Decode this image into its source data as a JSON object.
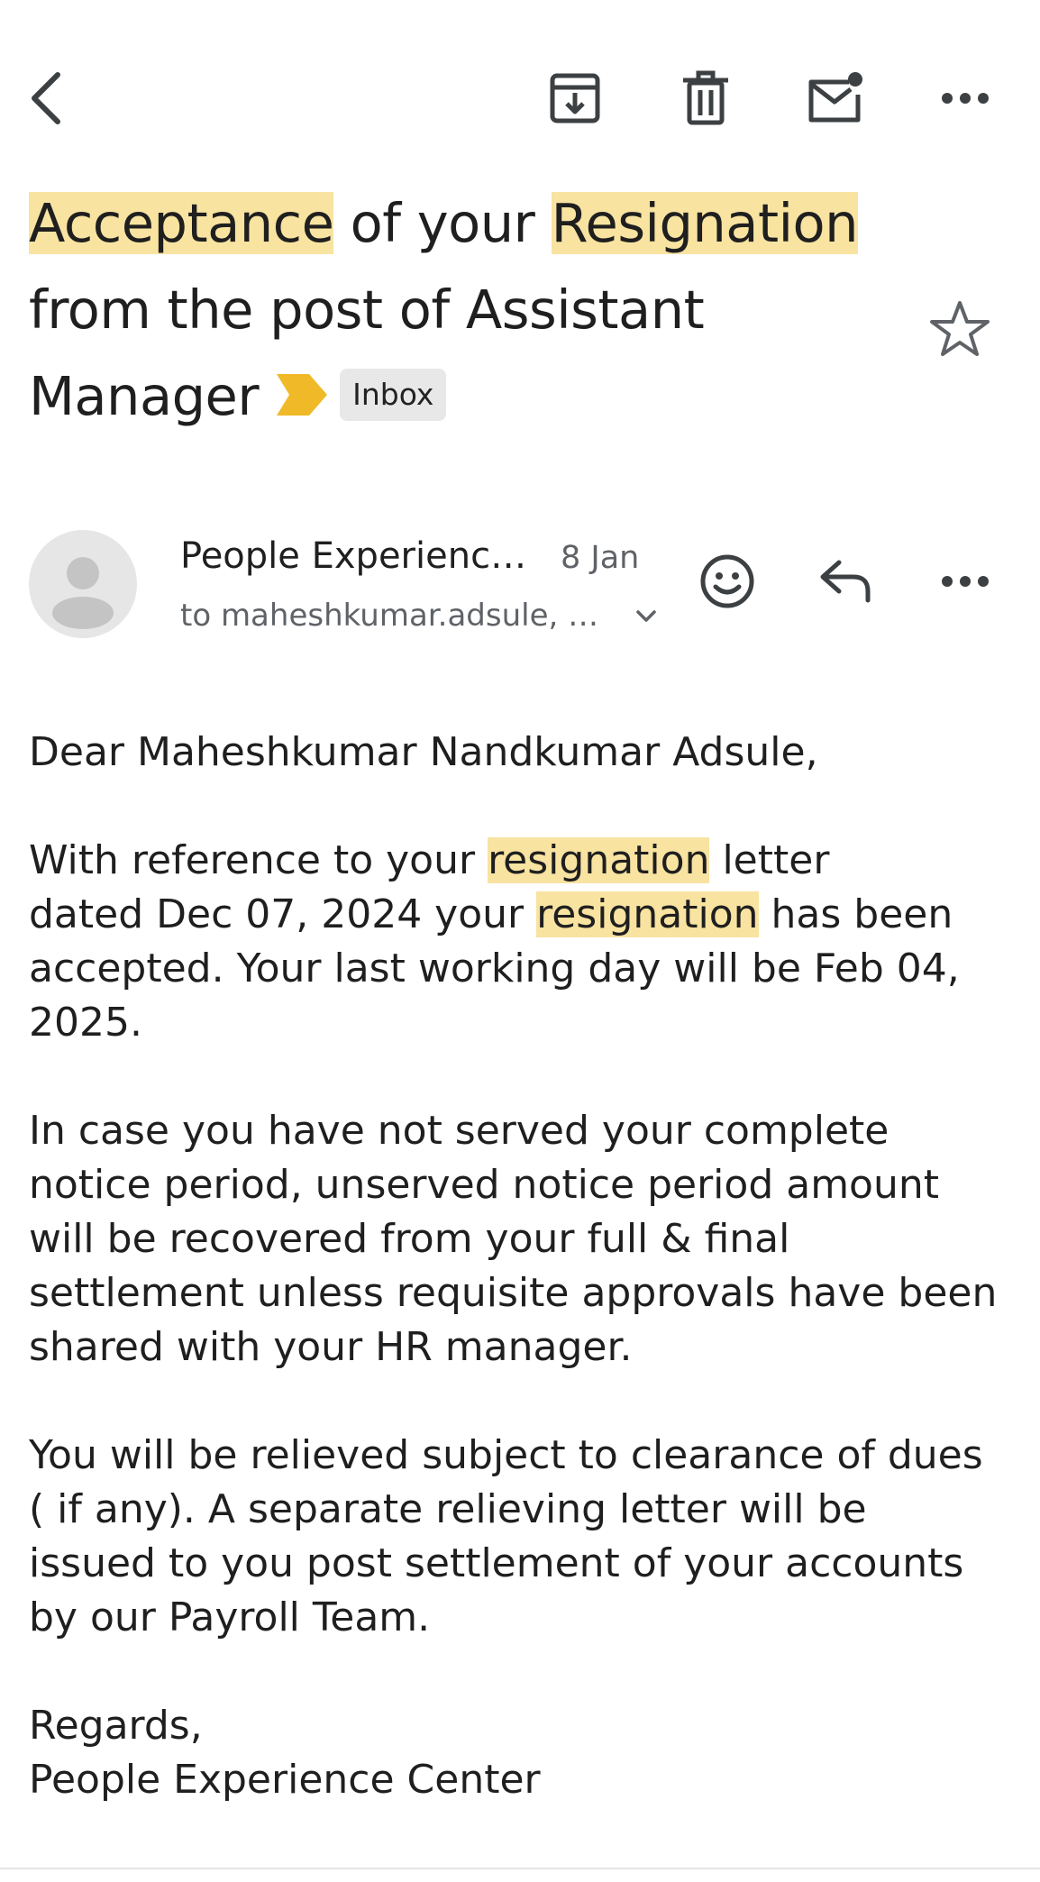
{
  "toolbar": {
    "back_icon": "back-arrow-icon",
    "archive_icon": "archive-icon",
    "delete_icon": "trash-icon",
    "mark_unread_icon": "mark-unread-icon",
    "more_icon": "more-horizontal-icon"
  },
  "subject": {
    "part1": "Acceptance",
    "part2": " of your ",
    "part3": "Resignation",
    "line2": "from the post of Assistant",
    "line3": "Manager",
    "label": "Inbox",
    "important_color": "#f0b928",
    "highlight_color": "#f8e3a1"
  },
  "message": {
    "sender": "People Experience…",
    "date": "8 Jan",
    "recipients": "to maheshkumar.adsule, s…",
    "react_icon": "smiley-icon",
    "reply_icon": "reply-icon",
    "more_icon": "more-horizontal-icon"
  },
  "body": {
    "greeting": "Dear Maheshkumar Nandkumar Adsule,",
    "p1_a": "With reference to your ",
    "p1_hl1": "resignation",
    "p1_b": " letter",
    "p1_c": "dated Dec 07, 2024 your ",
    "p1_hl2": "resignation",
    "p1_d": " has been",
    "p1_e": "accepted. Your last working day will be Feb 04,",
    "p1_f": "2025.",
    "p2_l1": "In case you have not served your complete",
    "p2_l2": "notice period, unserved notice period amount",
    "p2_l3": "will be recovered from your full & final",
    "p2_l4": "settlement unless requisite approvals have been",
    "p2_l5": "shared with your HR manager.",
    "p3_l1": "You will be relieved subject to clearance of dues",
    "p3_l2": "( if any). A separate relieving letter will be",
    "p3_l3": "issued to you post settlement of your accounts",
    "p3_l4": "by our Payroll Team.",
    "sign1": "Regards,",
    "sign2": "People Experience Center"
  }
}
